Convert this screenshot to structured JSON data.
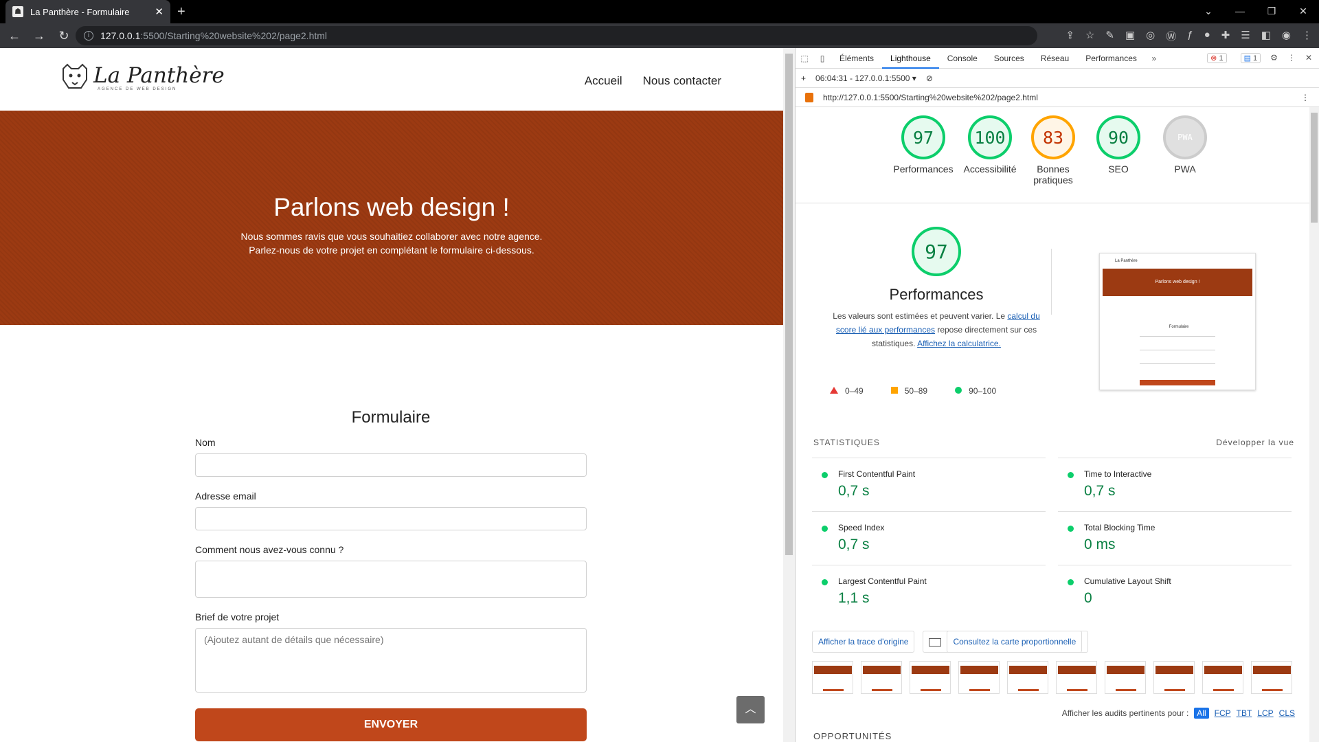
{
  "browser": {
    "tab_title": "La Panthère - Formulaire",
    "url_host": "127.0.0.1",
    "url_rest": ":5500/Starting%20website%202/page2.html"
  },
  "site": {
    "logo_name": "La Panthère",
    "logo_tagline": "AGENCE DE WEB DESIGN",
    "nav": [
      "Accueil",
      "Nous contacter"
    ],
    "hero_title": "Parlons web design !",
    "hero_line1": "Nous sommes ravis que vous souhaitiez collaborer avec notre agence.",
    "hero_line2": "Parlez-nous de votre projet en complétant le formulaire ci-dessous.",
    "form_title": "Formulaire",
    "label_name": "Nom",
    "label_email": "Adresse email",
    "label_source": "Comment nous avez-vous connu ?",
    "label_brief": "Brief de votre projet",
    "brief_placeholder": "(Ajoutez autant de détails que nécessaire)",
    "submit": "ENVOYER"
  },
  "devtools": {
    "tabs": [
      "Éléments",
      "Lighthouse",
      "Console",
      "Sources",
      "Réseau",
      "Performances"
    ],
    "errors": "1",
    "messages": "1",
    "report_time": "06:04:31 - 127.0.0.1:5500",
    "report_url": "http://127.0.0.1:5500/Starting%20website%202/page2.html",
    "gauges": [
      {
        "score": "97",
        "label": "Performances",
        "status": "pass"
      },
      {
        "score": "100",
        "label": "Accessibilité",
        "status": "pass"
      },
      {
        "score": "83",
        "label": "Bonnes pratiques",
        "status": "average"
      },
      {
        "score": "90",
        "label": "SEO",
        "status": "pass"
      },
      {
        "score": "PWA",
        "label": "PWA",
        "status": "na"
      }
    ],
    "perf_score": "97",
    "perf_title": "Performances",
    "perf_desc_1": "Les valeurs sont estimées et peuvent varier. Le ",
    "perf_desc_link1": "calcul du score lié aux performances",
    "perf_desc_2": " repose directement sur ces statistiques. ",
    "perf_desc_link2": "Affichez la calculatrice.",
    "legend": [
      "0–49",
      "50–89",
      "90–100"
    ],
    "stats_title": "STATISTIQUES",
    "expand": "Développer la vue",
    "metrics": [
      {
        "label": "First Contentful Paint",
        "value": "0,7 s"
      },
      {
        "label": "Time to Interactive",
        "value": "0,7 s"
      },
      {
        "label": "Speed Index",
        "value": "0,7 s"
      },
      {
        "label": "Total Blocking Time",
        "value": "0 ms"
      },
      {
        "label": "Largest Contentful Paint",
        "value": "1,1 s"
      },
      {
        "label": "Cumulative Layout Shift",
        "value": "0"
      }
    ],
    "btn_trace": "Afficher la trace d'origine",
    "btn_treemap": "Consultez la carte proportionnelle",
    "filter_label": "Afficher les audits pertinents pour :",
    "filters": [
      "All",
      "FCP",
      "TBT",
      "LCP",
      "CLS"
    ],
    "opportunities": "OPPORTUNITÉS",
    "thumb_title": "Parlons web design !",
    "thumb_form": "Formulaire",
    "thumb_logo": "La Panthère"
  },
  "colors": {
    "brand": "#9c3a12",
    "button": "#c0471b",
    "pass": "#0cce6b",
    "average": "#ffa400"
  }
}
